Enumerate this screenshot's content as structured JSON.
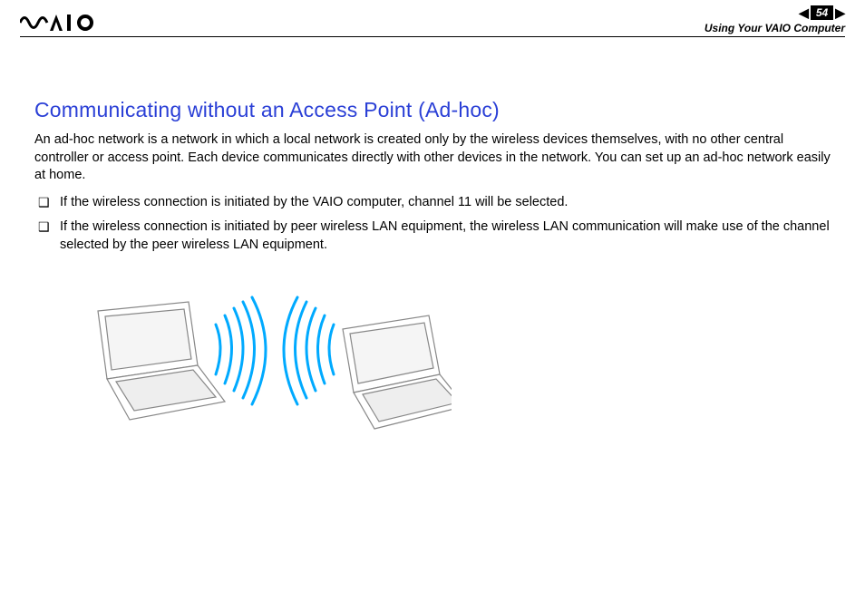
{
  "header": {
    "page_number": "54",
    "section": "Using Your VAIO Computer"
  },
  "content": {
    "title": "Communicating without an Access Point (Ad-hoc)",
    "paragraph": "An ad-hoc network is a network in which a local network is created only by the wireless devices themselves, with no other central controller or access point. Each device communicates directly with other devices in the network. You can set up an ad-hoc network easily at home.",
    "bullets": [
      "If the wireless connection is initiated by the VAIO computer, channel 11 will be selected.",
      "If the wireless connection is initiated by peer wireless LAN equipment, the wireless LAN communication will make use of the channel selected by the peer wireless LAN equipment."
    ]
  }
}
